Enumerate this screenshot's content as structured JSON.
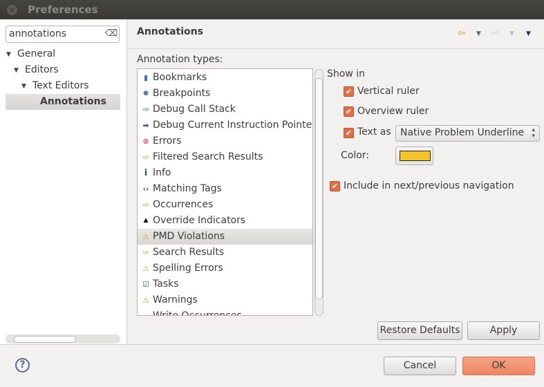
{
  "window": {
    "title": "Preferences"
  },
  "sidebar": {
    "search_value": "annotations",
    "tree": [
      {
        "label": "General"
      },
      {
        "label": "Editors"
      },
      {
        "label": "Text Editors"
      },
      {
        "label": "Annotations"
      }
    ]
  },
  "main": {
    "header": "Annotations",
    "types_label": "Annotation types:",
    "types": [
      {
        "label": "Bookmarks",
        "icon": "bookmark-icon"
      },
      {
        "label": "Breakpoints",
        "icon": "breakpoint-icon"
      },
      {
        "label": "Debug Call Stack",
        "icon": "arrow-outline-icon"
      },
      {
        "label": "Debug Current Instruction Pointer",
        "icon": "arrow-filled-icon"
      },
      {
        "label": "Errors",
        "icon": "error-icon"
      },
      {
        "label": "Filtered Search Results",
        "icon": "search-arrow-icon"
      },
      {
        "label": "Info",
        "icon": "info-icon"
      },
      {
        "label": "Matching Tags",
        "icon": "tags-icon"
      },
      {
        "label": "Occurrences",
        "icon": "search-arrow-icon"
      },
      {
        "label": "Override Indicators",
        "icon": "override-icon"
      },
      {
        "label": "PMD Violations",
        "icon": "warning-icon",
        "selected": true
      },
      {
        "label": "Search Results",
        "icon": "search-arrow-icon"
      },
      {
        "label": "Spelling Errors",
        "icon": "warning-icon"
      },
      {
        "label": "Tasks",
        "icon": "task-icon"
      },
      {
        "label": "Warnings",
        "icon": "warning-icon"
      },
      {
        "label": "Write Occurrences",
        "icon": "search-arrow-icon"
      }
    ],
    "show_in": "Show in",
    "vertical_ruler": {
      "label": "Vertical ruler",
      "checked": true
    },
    "overview_ruler": {
      "label": "Overview ruler",
      "checked": true
    },
    "text_as": {
      "label": "Text as",
      "checked": true,
      "value": "Native Problem Underline"
    },
    "color_label": "Color:",
    "color": "#f4c327",
    "include_nav": {
      "label": "Include in next/previous navigation",
      "checked": true
    },
    "restore_defaults": "Restore Defaults",
    "apply": "Apply"
  },
  "footer": {
    "cancel": "Cancel",
    "ok": "OK"
  },
  "colors": {
    "accent": "#e0704a",
    "ok_button": "#f19373"
  }
}
